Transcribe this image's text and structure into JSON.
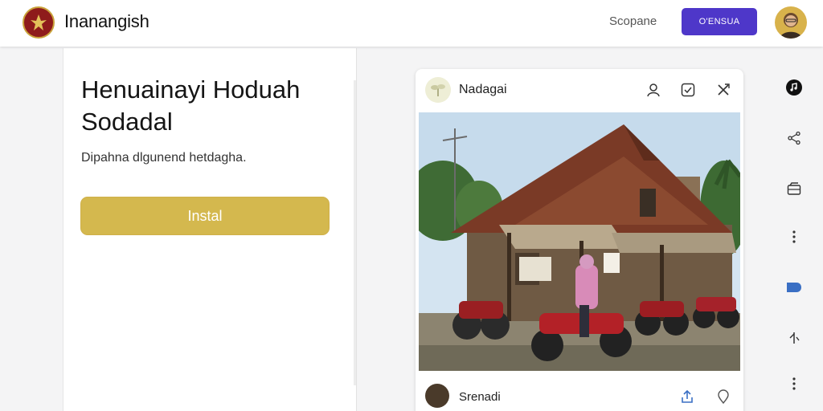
{
  "header": {
    "app_title": "Inanangish",
    "link_label": "Scopane",
    "button_label": "O'ENSUA"
  },
  "left_panel": {
    "title": "Henuainayi Hoduah Sodadal",
    "subtitle": "Dipahna dlgunend hetdagha.",
    "install_label": "Instal",
    "install_color": "#d4b84e"
  },
  "post": {
    "author": "Nadagai",
    "footer_name": "Srenadi",
    "header_icons": [
      "user-icon",
      "checkbox-icon",
      "close-icon"
    ],
    "footer_icons": [
      "share-icon",
      "location-icon"
    ]
  },
  "right_rail": {
    "icons": [
      "music-icon",
      "share-icon",
      "inbox-icon",
      "more-vertical-icon",
      "tag-icon",
      "rotate-icon",
      "more-vertical-icon"
    ]
  },
  "colors": {
    "accent": "#4e37c9",
    "brand_red": "#8e1b1b",
    "gold": "#c9a23a"
  }
}
